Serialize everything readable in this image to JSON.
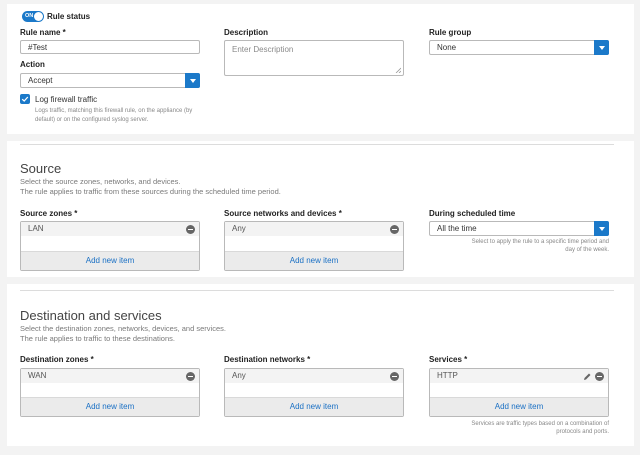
{
  "general": {
    "toggle_label": "ON",
    "rule_status_label": "Rule status",
    "rule_name_label": "Rule name *",
    "rule_name_value": "#Test",
    "action_label": "Action",
    "action_value": "Accept",
    "log_label": "Log firewall traffic",
    "log_help_line1": "Logs traffic, matching this firewall rule, on the appliance (by",
    "log_help_line2": "default) or on the configured syslog server.",
    "description_label": "Description",
    "description_placeholder": "Enter Description",
    "rule_group_label": "Rule group",
    "rule_group_value": "None"
  },
  "source": {
    "title": "Source",
    "desc_line1": "Select the source zones, networks, and devices.",
    "desc_line2": "The rule applies to traffic from these sources during the scheduled time period.",
    "zones_label": "Source zones *",
    "zones_item": "LAN",
    "networks_label": "Source networks and devices *",
    "networks_item": "Any",
    "schedule_label": "During scheduled time",
    "schedule_value": "All the time",
    "schedule_help_line1": "Select to apply the rule to a specific time period and",
    "schedule_help_line2": "day of the week.",
    "add_label": "Add new item"
  },
  "destination": {
    "title": "Destination and services",
    "desc_line1": "Select the destination zones, networks, devices, and services.",
    "desc_line2": "The rule applies to traffic to these destinations.",
    "zones_label": "Destination zones *",
    "zones_item": "WAN",
    "networks_label": "Destination networks *",
    "networks_item": "Any",
    "services_label": "Services *",
    "services_item": "HTTP",
    "services_help_line1": "Services are traffic types based on a combination of",
    "services_help_line2": "protocols and ports.",
    "add_label": "Add new item"
  },
  "colors": {
    "accent": "#1b79c9",
    "link": "#1a70c4"
  },
  "icons": [
    "check-icon",
    "chevron-down-icon",
    "remove-icon",
    "edit-icon"
  ]
}
